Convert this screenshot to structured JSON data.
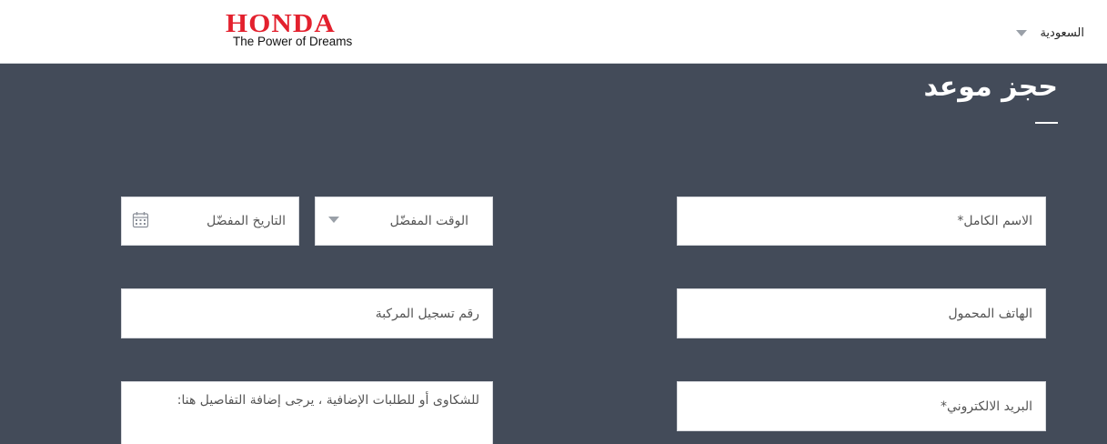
{
  "header": {
    "brand": {
      "wordmark": "HONDA",
      "tagline": "The Power of Dreams",
      "color": "#e3212e"
    },
    "country_selector": {
      "label": "السعودية",
      "icon": "chevron-down-icon"
    }
  },
  "page": {
    "title": "حجز موعد",
    "background_color": "#434b59"
  },
  "form": {
    "full_name": {
      "placeholder": "الاسم الكامل*",
      "value": ""
    },
    "mobile": {
      "placeholder": "الهاتف المحمول",
      "value": ""
    },
    "email": {
      "placeholder": "البريد الالكتروني*",
      "value": ""
    },
    "preferred_time": {
      "label": "الوقت المفضّل",
      "icon": "chevron-down-icon"
    },
    "preferred_date": {
      "placeholder": "التاريخ المفضّل",
      "value": "",
      "icon": "calendar-icon"
    },
    "plate_number": {
      "placeholder": "رقم تسجيل المركبة",
      "value": ""
    },
    "notes": {
      "placeholder": "للشكاوى أو للطلبات الإضافية ، يرجى إضافة التفاصيل هنا:",
      "value": ""
    }
  }
}
